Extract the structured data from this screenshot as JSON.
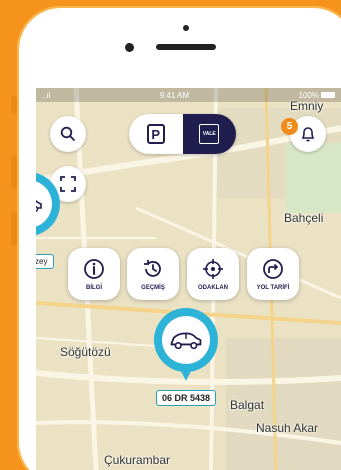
{
  "status_bar": {
    "signal": "..ıl",
    "time": "9:41 AM",
    "battery": "100%"
  },
  "toggle": {
    "parking_label": "P",
    "vale_label": "VALE"
  },
  "notifications": {
    "count": "5"
  },
  "actions": [
    {
      "label": "BİLGİ",
      "icon": "info-icon"
    },
    {
      "label": "GEÇMİŞ",
      "icon": "history-icon"
    },
    {
      "label": "ODAKLAN",
      "icon": "focus-icon"
    },
    {
      "label": "YOL TARİFİ",
      "icon": "directions-icon"
    }
  ],
  "map": {
    "labels": {
      "emniy": "Emniy",
      "bahceli": "Bahçeli",
      "sogutozu": "Söğütözü",
      "balgat": "Balgat",
      "nasuh_akar": "Nasuh Akar",
      "cukurambar": "Çukurambar"
    },
    "plate_left": "zey",
    "selected_plate": "06 DR 5438"
  },
  "colors": {
    "brand_orange": "#f6931d",
    "navy": "#201d4f",
    "pin_blue": "#2db2d8"
  }
}
